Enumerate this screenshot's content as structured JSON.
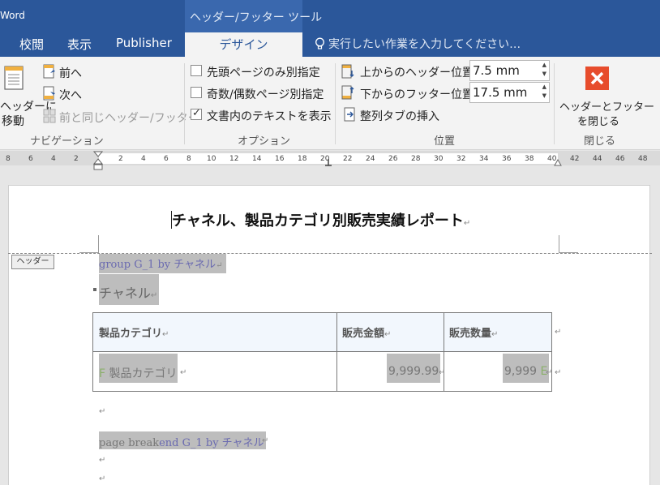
{
  "app": {
    "name": "Word",
    "context_tool": "ヘッダー/フッター ツール"
  },
  "tabs": {
    "review": "校閲",
    "view": "表示",
    "publisher": "Publisher",
    "design": "デザイン"
  },
  "tell_me": "実行したい作業を入力してください…",
  "ribbon": {
    "navigation": {
      "goto_line1": "ヘッダーに",
      "goto_line2": "移動",
      "previous": "前へ",
      "next": "次へ",
      "link_previous": "前と同じヘッダー/フッター",
      "group": "ナビゲーション"
    },
    "options": {
      "first_page": "先頭ページのみ別指定",
      "odd_even": "奇数/偶数ページ別指定",
      "show_text": "文書内のテキストを表示",
      "first_page_checked": false,
      "odd_even_checked": false,
      "show_text_checked": true,
      "group": "オプション"
    },
    "position": {
      "header_label": "上からのヘッダー位置:",
      "header_value": "7.5 mm",
      "footer_label": "下からのフッター位置:",
      "footer_value": "17.5 mm",
      "align_tab": "整列タブの挿入",
      "group": "位置"
    },
    "close": {
      "label_line1": "ヘッダーとフッター",
      "label_line2": "を閉じる",
      "group": "閉じる",
      "icon_color": "#e74c2c"
    }
  },
  "ruler": {
    "left_ticks": [
      "8",
      "6",
      "4",
      "2"
    ],
    "ticks": [
      "2",
      "4",
      "6",
      "8",
      "10",
      "12",
      "14",
      "16",
      "18",
      "20",
      "22",
      "24",
      "26",
      "28",
      "30",
      "32",
      "34",
      "36",
      "38",
      "40",
      "42",
      "44",
      "46",
      "48"
    ]
  },
  "document": {
    "title": "チャネル、製品カテゴリ別販売実績レポート",
    "header_tag": "ヘッダー",
    "group_field": "group G_1 by  チャネル",
    "channel_field": "チャネル",
    "table": {
      "headers": [
        "製品カテゴリ",
        "販売金額",
        "販売数量"
      ],
      "row": {
        "category_prefix": "F",
        "category": "製品カテゴリ",
        "amount": "9,999.99",
        "quantity": "9,999",
        "quantity_suffix": "E"
      }
    },
    "page_break_prefix": "page break",
    "page_break_field": "end G_1 by  チャネル",
    "para_mark": "↵"
  },
  "colors": {
    "title_bar": "#2b579a",
    "field_shade": "#bdbdbd",
    "field_text": "#6a6ab0"
  }
}
